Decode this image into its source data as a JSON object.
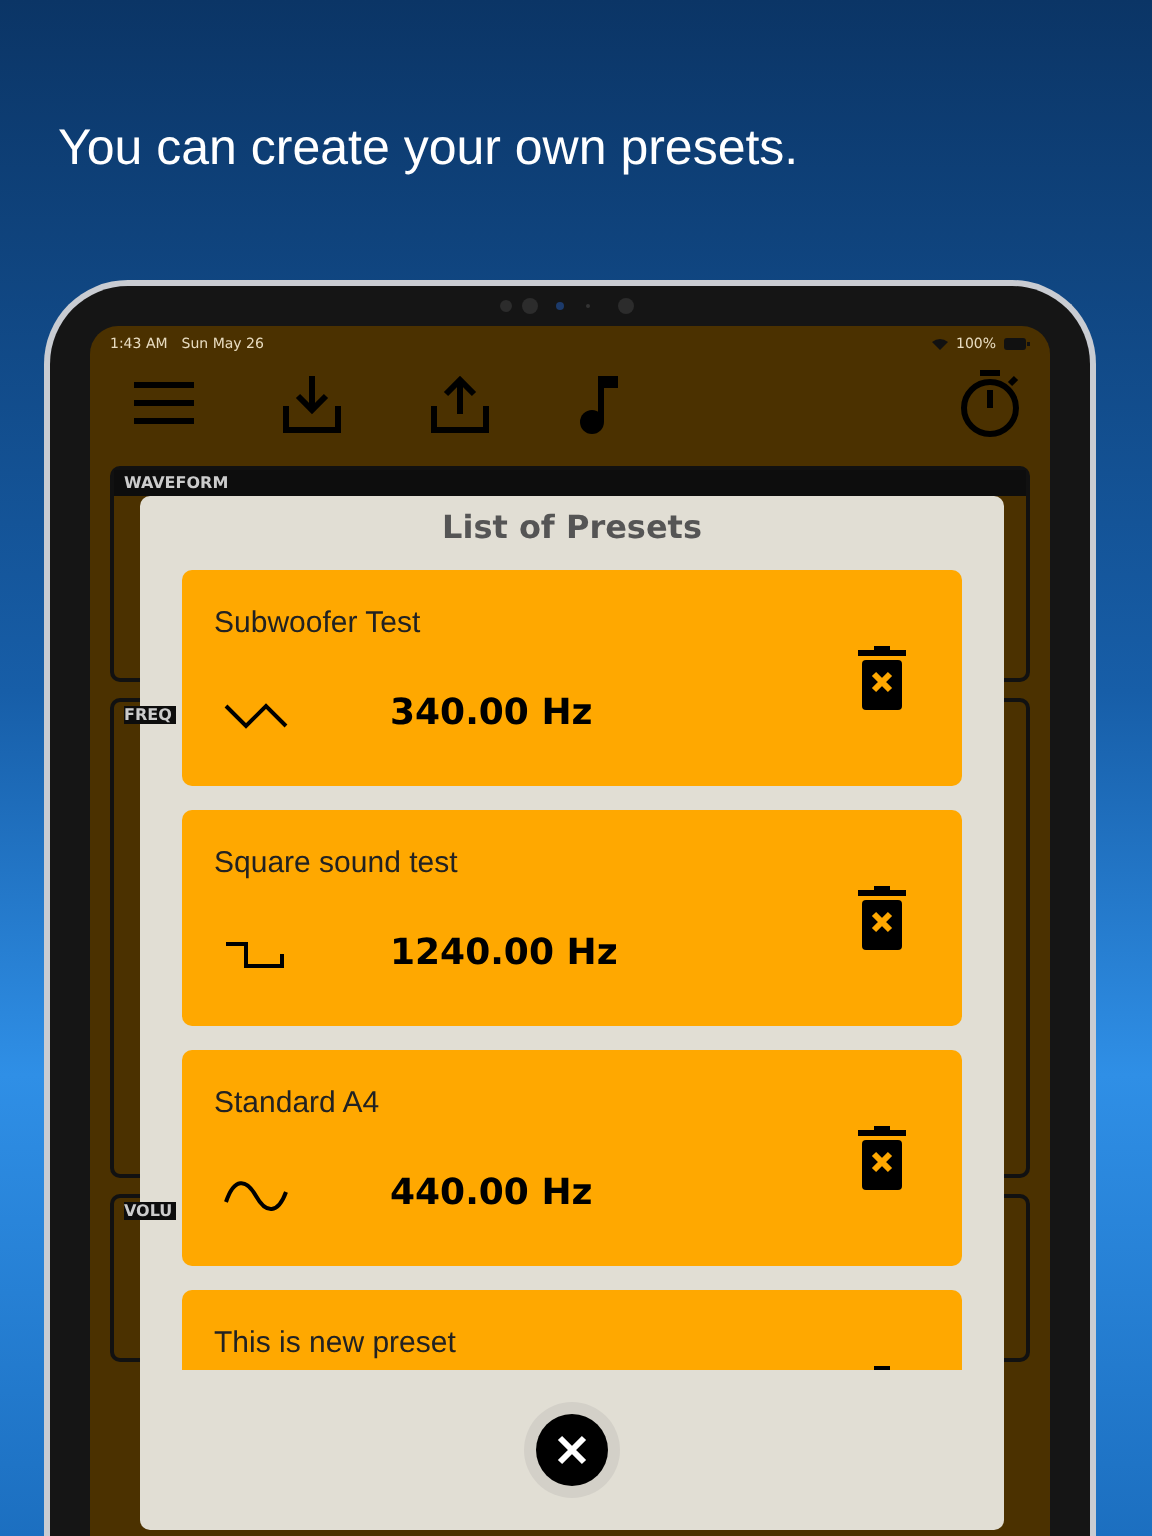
{
  "headline": "You can create your own presets.",
  "status_bar": {
    "time": "1:43 AM",
    "date": "Sun May 26",
    "battery": "100%"
  },
  "panels": [
    {
      "label": "WAVEFORM",
      "kind": "waveform"
    },
    {
      "label": "FREQ",
      "kind": "frequency"
    },
    {
      "label": "VOLU",
      "kind": "volume"
    }
  ],
  "dialog": {
    "title": "List of Presets",
    "presets": [
      {
        "name": "Subwoofer Test",
        "kind": "triangle",
        "frequency": "340.00 Hz"
      },
      {
        "name": "Square sound test",
        "kind": "square",
        "frequency": "1240.00 Hz"
      },
      {
        "name": "Standard A4",
        "kind": "sine",
        "frequency": "440.00 Hz"
      },
      {
        "name": "This is new preset"
      }
    ]
  }
}
